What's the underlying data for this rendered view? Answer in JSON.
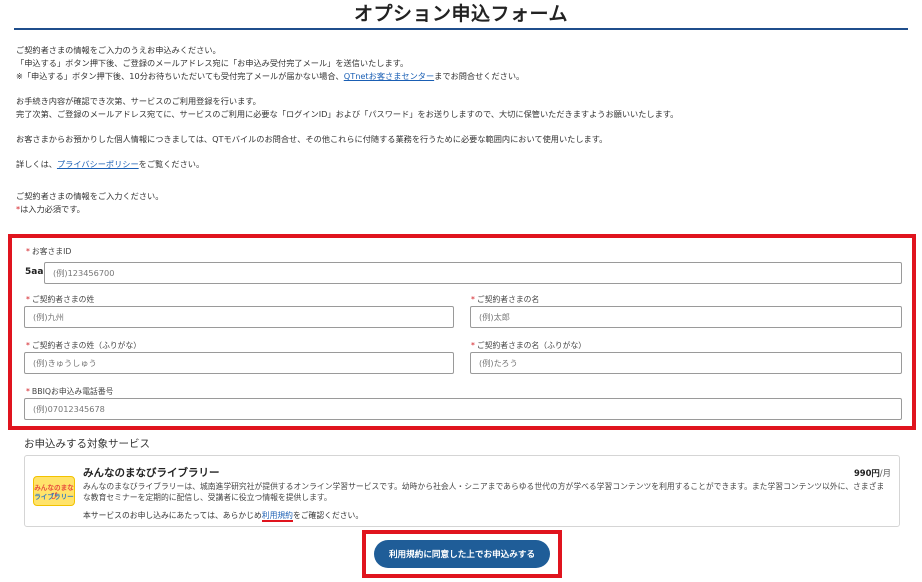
{
  "page_title": "オプション申込フォーム",
  "intro": {
    "line1": "ご契約者さまの情報をご入力のうえお申込みください。",
    "line2": "「申込する」ボタン押下後、ご登録のメールアドレス宛に「お申込み受付完了メール」を送信いたします。",
    "line3_before": "※「申込する」ボタン押下後、10分お待ちいただいても受付完了メールが届かない場合、",
    "line3_link": "QTnetお客さまセンター",
    "line3_after": "までお問合せください。",
    "line4": "お手続き内容が確認でき次第、サービスのご利用登録を行います。",
    "line5": "完了次第、ご登録のメールアドレス宛てに、サービスのご利用に必要な「ログインID」および「パスワード」をお送りしますので、大切に保管いただきますようお願いいたします。",
    "line6": "お客さまからお預かりした個人情報につきましては、QTモバイルのお問合せ、その他これらに付随する業務を行うために必要な範囲内において使用いたします。",
    "line7_before": "詳しくは、",
    "line7_link": "プライバシーポリシー",
    "line7_after": "をご覧ください。",
    "line8": "ご契約者さまの情報をご入力ください。",
    "required_mark": "*",
    "required_note": "は入力必須です。"
  },
  "form": {
    "required_mark": "*",
    "customer_id": {
      "label": "お客さまID",
      "prefix": "5aa",
      "placeholder": "(例)123456700",
      "value": ""
    },
    "last_name": {
      "label": "ご契約者さまの姓",
      "placeholder": "(例)九州",
      "value": ""
    },
    "first_name": {
      "label": "ご契約者さまの名",
      "placeholder": "(例)太郎",
      "value": ""
    },
    "last_name_kana": {
      "label": "ご契約者さまの姓（ふりがな）",
      "placeholder": "(例)きゅうしゅう",
      "value": ""
    },
    "first_name_kana": {
      "label": "ご契約者さまの名（ふりがな）",
      "placeholder": "(例)たろう",
      "value": ""
    },
    "phone": {
      "label": "BBIQお申込み電話番号",
      "placeholder": "(例)07012345678",
      "value": ""
    }
  },
  "service_section": {
    "heading": "お申込みする対象サービス",
    "service": {
      "logo_line1": "みんなのまなび",
      "logo_line2": "ライブラリー",
      "name": "みんなのまなびライブラリー",
      "price": "990円",
      "price_unit": "/月",
      "description": "みんなのまなびライブラリーは、城南進学研究社が提供するオンライン学習サービスです。幼時から社会人・シニアまであらゆる世代の方が学べる学習コンテンツを利用することができます。また学習コンテンツ以外に、さまざまな教育セミナーを定期的に配信し、受講者に役立つ情報を提供します。",
      "note_before": "本サービスのお申し込みにあたっては、あらかじめ",
      "note_link": "利用規約",
      "note_after": "をご確認ください。"
    }
  },
  "submit_label": "利用規約に同意した上でお申込みする",
  "colors": {
    "accent_blue": "#1f5d98",
    "link_blue": "#1a5fb4",
    "highlight_red": "#e0141e",
    "title_rule": "#1f4e8c"
  }
}
